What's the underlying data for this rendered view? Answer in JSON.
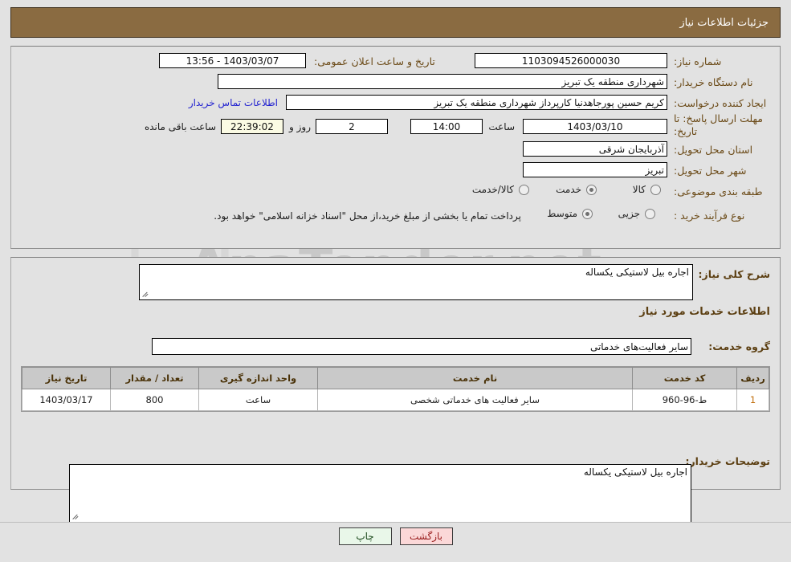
{
  "header": {
    "title": "جزئیات اطلاعات نیاز"
  },
  "top_form": {
    "need_number_label": "شماره نیاز:",
    "need_number_value": "1103094526000030",
    "announce_label": "تاریخ و ساعت اعلان عمومی:",
    "announce_value": "1403/03/07 - 13:56",
    "buyer_org_label": "نام دستگاه خریدار:",
    "buyer_org_value": "شهرداری منطقه یک تبریز",
    "buyer_org_value2": "شهرداری منطقه یک تبریز",
    "creator_label": "ایجاد کننده درخواست:",
    "creator_value": "کریم حسین پورجاهدنیا کارپرداز شهرداری منطقه یک تبریز",
    "contact_link": "اطلاعات تماس خریدار",
    "deadline_label": "مهلت ارسال پاسخ: تا تاریخ:",
    "deadline_date": "1403/03/10",
    "hour_label": "ساعت",
    "hour_value": "14:00",
    "days_value": "2",
    "days_word": "روز و",
    "countdown_value": "22:39:02",
    "remaining_label": "ساعت باقی مانده",
    "province_label": "استان محل تحویل:",
    "province_value": "آذربایجان شرقی",
    "city_label": "شهر محل تحویل:",
    "city_value": "تبریز",
    "category_label": "طبقه بندی موضوعی:",
    "category_options": [
      {
        "label": "کالا",
        "selected": false
      },
      {
        "label": "خدمت",
        "selected": true
      },
      {
        "label": "کالا/خدمت",
        "selected": false
      }
    ],
    "process_label": "نوع فرآیند خرید :",
    "process_options": [
      {
        "label": "جزیی",
        "selected": false
      },
      {
        "label": "متوسط",
        "selected": true
      }
    ],
    "payment_note": "پرداخت تمام یا بخشی از مبلغ خرید،از محل \"اسناد خزانه اسلامی\" خواهد بود."
  },
  "mid_form": {
    "general_desc_label": "شرح کلی نیاز:",
    "general_desc_value": "اجاره بیل لاستیکی یکساله",
    "services_heading": "اطلاعات خدمات مورد نیاز",
    "service_group_label": "گروه خدمت:",
    "service_group_value": "سایر فعالیت‌های خدماتی",
    "buyer_notes_label": "توضیحات خریدار:",
    "buyer_notes_value": "اجاره بیل لاستیکی یکساله"
  },
  "table": {
    "columns": [
      "ردیف",
      "کد خدمت",
      "نام خدمت",
      "واحد اندازه گیری",
      "تعداد / مقدار",
      "تاریخ نیاز"
    ],
    "rows": [
      {
        "row": "1",
        "code": "ط-96-960",
        "name": "سایر فعالیت های خدماتی شخصی",
        "unit": "ساعت",
        "qty": "800",
        "date": "1403/03/17"
      }
    ]
  },
  "footer": {
    "print_label": "چاپ",
    "back_label": "بازگشت"
  },
  "watermark": {
    "text": "AnaTender.net"
  },
  "colors": {
    "title_bar": "#8a6b41",
    "label": "#6b4a17",
    "link": "#2222d0",
    "row_number": "#c2700f",
    "print_button": "#e9f7e9",
    "back_button": "#fbd8d8",
    "countdown_field": "#fbfbe4"
  }
}
